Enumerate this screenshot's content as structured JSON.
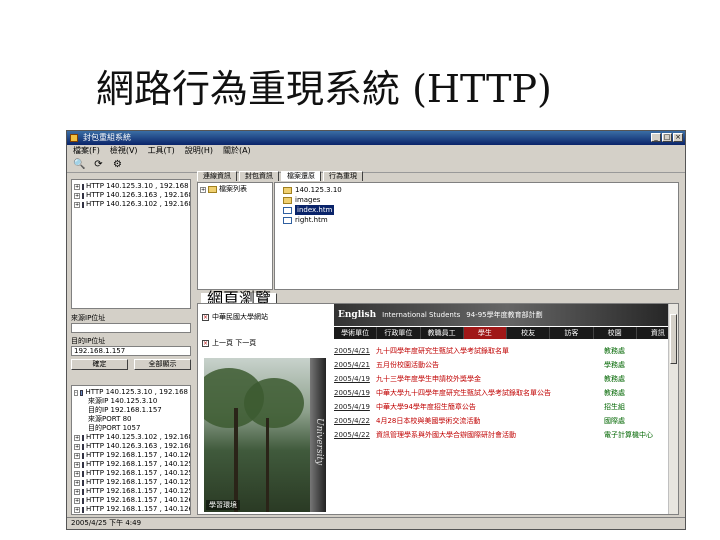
{
  "slide": {
    "title": "網路行為重現系統 (HTTP)"
  },
  "window": {
    "title": "封包重組系統",
    "controls": [
      "_",
      "□",
      "×"
    ]
  },
  "menu": [
    "檔案(F)",
    "檢視(V)",
    "工具(T)",
    "說明(H)",
    "關於(A)"
  ],
  "toolbar": [
    {
      "icon": "search-icon",
      "glyph": "🔍"
    },
    {
      "icon": "refresh-icon",
      "glyph": "⟳"
    },
    {
      "icon": "settings-icon",
      "glyph": "⚙"
    }
  ],
  "left_tree": [
    {
      "exp": "+",
      "text": "HTTP 140.125.3.10 , 192.168"
    },
    {
      "exp": "+",
      "text": "HTTP 140.126.3.163 , 192.168"
    },
    {
      "exp": "+",
      "text": "HTTP 140.126.3.102 , 192.168"
    }
  ],
  "form": {
    "label_src": "來源IP位址",
    "src_value": "",
    "label_dst": "目的IP位址",
    "dst_value": "192.168.1.157",
    "btn_ok": "確定",
    "btn_cancel": "全部顯示"
  },
  "left_tree2": [
    {
      "exp": "-",
      "text": "HTTP 140.125.3.10 , 192.168"
    },
    {
      "exp": "",
      "text": "來源IP 140.125.3.10"
    },
    {
      "exp": "",
      "text": "目的IP 192.168.1.157"
    },
    {
      "exp": "",
      "text": "來源PORT 80"
    },
    {
      "exp": "",
      "text": "目的PORT 1057"
    },
    {
      "exp": "+",
      "text": "HTTP 140.125.3.102 , 192.168"
    },
    {
      "exp": "+",
      "text": "HTTP 140.126.3.163 , 192.168"
    },
    {
      "exp": "+",
      "text": "HTTP 192.168.1.157 , 140.126"
    },
    {
      "exp": "+",
      "text": "HTTP 192.168.1.157 , 140.125"
    },
    {
      "exp": "+",
      "text": "HTTP 192.168.1.157 , 140.125"
    },
    {
      "exp": "+",
      "text": "HTTP 192.168.1.157 , 140.125"
    },
    {
      "exp": "+",
      "text": "HTTP 192.168.1.157 , 140.125"
    },
    {
      "exp": "+",
      "text": "HTTP 192.168.1.157 , 140.126"
    },
    {
      "exp": "+",
      "text": "HTTP 192.168.1.157 , 140.126"
    },
    {
      "exp": "+",
      "text": "HTTP 192.168.1.157 , 140.126"
    }
  ],
  "tabs_top": [
    "連線資訊",
    "封包資訊",
    "檔案還原",
    "行為重現"
  ],
  "mid_tree": [
    {
      "text": "檔案列表"
    }
  ],
  "file_list": [
    {
      "text": "140.125.3.10",
      "selected": false
    },
    {
      "text": "images",
      "selected": false
    },
    {
      "text": "index.htm",
      "selected": true
    },
    {
      "text": "right.htm",
      "selected": false
    }
  ],
  "tab_bottom": "網頁瀏覽",
  "preview": {
    "check1": "中華民國大學網站",
    "check2": "上一頁 下一頁",
    "photo_text": "University",
    "photo_caption": "學習環境",
    "web_header": {
      "en": "English",
      "intl": "International Students",
      "extra": "94-95學年度教育部計劃"
    },
    "nav": [
      "學術單位",
      "行政單位",
      "教職員工",
      "學生",
      "校友",
      "訪客",
      "校園",
      "資訊"
    ],
    "news": [
      {
        "date": "2005/4/21",
        "title": "九十四學年度研究生甄試入學考試錄取名單",
        "dept": "教務處"
      },
      {
        "date": "2005/4/21",
        "title": "五月份校園活動公告",
        "dept": "學務處"
      },
      {
        "date": "2005/4/19",
        "title": "九十三學年度學生申請校外獎學金",
        "dept": "教務處"
      },
      {
        "date": "2005/4/19",
        "title": "中華大學九十四學年度研究生甄試入學考試錄取名單公告",
        "dept": "教務處"
      },
      {
        "date": "2005/4/19",
        "title": "中華大學94學年度招生簡章公告",
        "dept": "招生組"
      },
      {
        "date": "2005/4/22",
        "title": "4月28日本校與美國學術交流活動",
        "dept": "國際處"
      },
      {
        "date": "2005/4/22",
        "title": "資訊管理學系與外國大學合辦國際研討會活動",
        "dept": "電子計算機中心"
      }
    ]
  },
  "status": "2005/4/25 下午 4:49"
}
